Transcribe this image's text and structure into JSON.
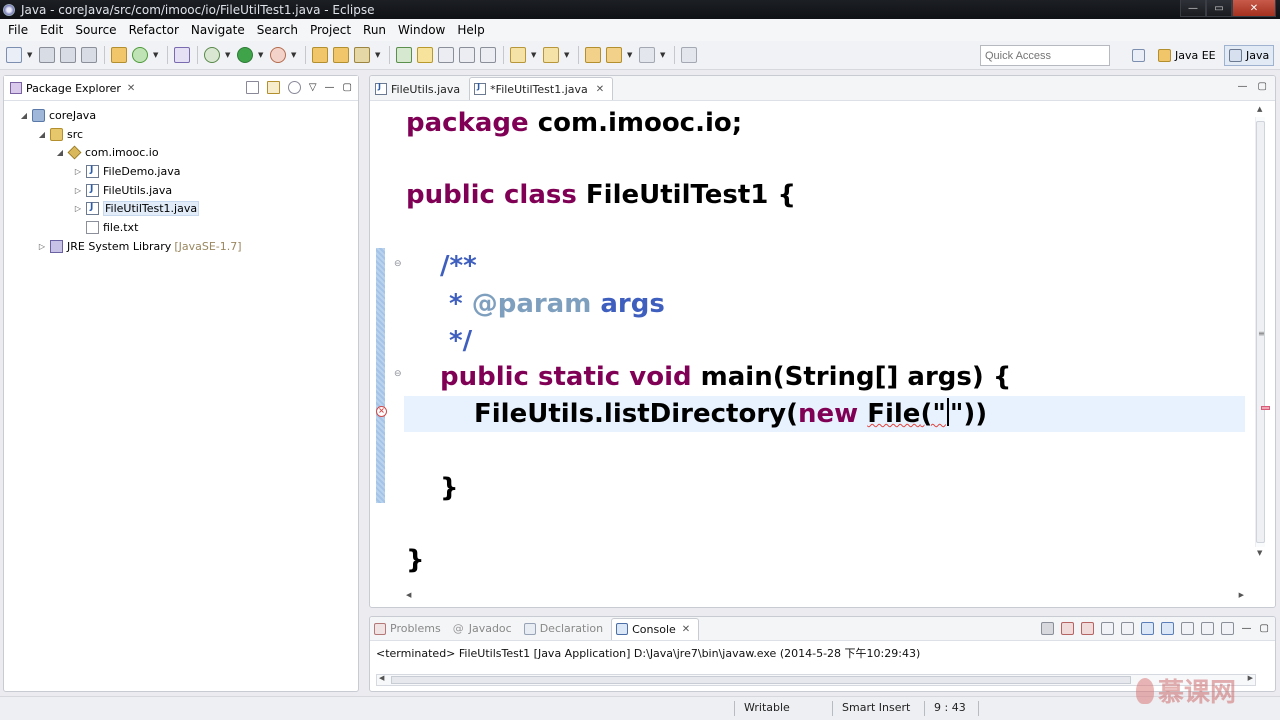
{
  "window": {
    "title": "Java - coreJava/src/com/imooc/io/FileUtilTest1.java - Eclipse",
    "controls": [
      "—",
      "▭",
      "✕"
    ]
  },
  "menu": [
    "File",
    "Edit",
    "Source",
    "Refactor",
    "Navigate",
    "Search",
    "Project",
    "Run",
    "Window",
    "Help"
  ],
  "toolbar": {
    "quick_access_placeholder": "Quick Access",
    "perspectives": [
      "Java EE",
      "Java"
    ]
  },
  "package_explorer": {
    "title": "Package Explorer",
    "tree": [
      {
        "label": "coreJava",
        "icon": "project-icon"
      },
      {
        "label": "src",
        "icon": "source-folder-icon"
      },
      {
        "label": "com.imooc.io",
        "icon": "package-icon"
      },
      {
        "label": "FileDemo.java",
        "icon": "java-file-icon"
      },
      {
        "label": "FileUtils.java",
        "icon": "java-file-icon"
      },
      {
        "label": "FileUtilTest1.java",
        "icon": "java-file-icon",
        "selected": true
      },
      {
        "label": "file.txt",
        "icon": "text-file-icon"
      },
      {
        "label": "JRE System Library",
        "decoration": "[JavaSE-1.7]",
        "icon": "library-icon"
      }
    ]
  },
  "editor": {
    "tabs": [
      {
        "label": "FileUtils.java",
        "active": false
      },
      {
        "label": "*FileUtilTest1.java",
        "active": true
      }
    ],
    "code": {
      "l1_kw": "package",
      "l1_rest": " com.imooc.io;",
      "l2_kw": "public class",
      "l2_rest": " FileUtilTest1 {",
      "l3": "/**",
      "l4_star": " * ",
      "l4_tag": "@param",
      "l4_arg": " args",
      "l5": " */",
      "l6_kw": "public static void",
      "l6_rest": " main(String[] args) {",
      "l7_pre": "FileUtils.listDirectory(",
      "l7_kw": "new",
      "l7_sp": " ",
      "l7_file": "File",
      "l7_q1": "(\"",
      "l7_q2": "\"))",
      "l8": "}",
      "l9": "}"
    }
  },
  "console": {
    "tabs": [
      {
        "label": "Problems",
        "active": false
      },
      {
        "label": "Javadoc",
        "active": false
      },
      {
        "label": "Declaration",
        "active": false
      },
      {
        "label": "Console",
        "active": true
      }
    ],
    "output": "<terminated> FileUtilsTest1 [Java Application] D:\\Java\\jre7\\bin\\javaw.exe (2014-5-28 下午10:29:43)"
  },
  "status": {
    "writable": "Writable",
    "insert_mode": "Smart Insert",
    "position": "9 : 43"
  },
  "watermark": "慕课网",
  "colors": {
    "keyword": "#7f0055",
    "javadoc": "#3f5fbf",
    "javadoc_tag": "#7f9fbf",
    "error": "#e0443e",
    "current_line": "#e8f2fe"
  }
}
